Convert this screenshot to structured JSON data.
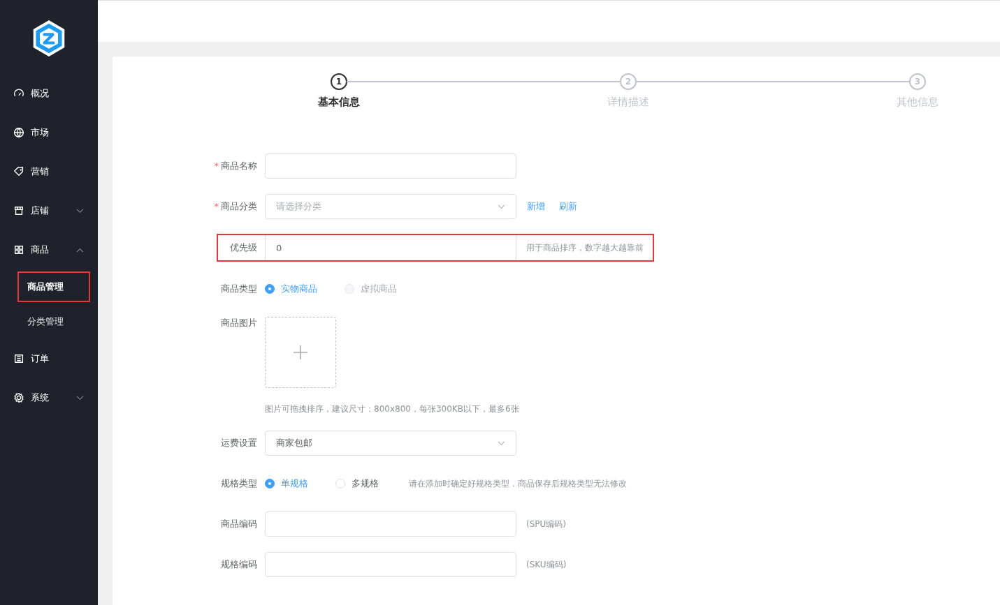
{
  "sidebar": {
    "items": [
      {
        "label": "概况"
      },
      {
        "label": "市场"
      },
      {
        "label": "营销"
      },
      {
        "label": "店铺",
        "expanded": false
      },
      {
        "label": "商品",
        "expanded": true,
        "children": [
          {
            "label": "商品管理",
            "selected": true,
            "highlighted": true
          },
          {
            "label": "分类管理",
            "selected": false,
            "highlighted": false
          }
        ]
      },
      {
        "label": "订单"
      },
      {
        "label": "系统",
        "expanded": false
      }
    ]
  },
  "steps": [
    {
      "number": "1",
      "label": "基本信息",
      "selected": true
    },
    {
      "number": "2",
      "label": "详情描述",
      "selected": false
    },
    {
      "number": "3",
      "label": "其他信息",
      "selected": false
    }
  ],
  "form": {
    "fields": [
      {
        "kind": "input",
        "required_mark": "*",
        "label": "商品名称",
        "highlighted": false
      },
      {
        "kind": "select",
        "required_mark": "*",
        "label": "商品分类",
        "placeholder": "请选择分类",
        "links": [
          "新增",
          "刷新"
        ],
        "highlighted": false
      },
      {
        "kind": "input",
        "label": "优先级",
        "value": "0",
        "append": "用于商品排序，数字越大越靠前",
        "highlighted": true
      },
      {
        "kind": "radio",
        "label": "商品类型",
        "options": [
          {
            "label": "实物商品",
            "selected": true,
            "disabled": false
          },
          {
            "label": "虚拟商品",
            "selected": false,
            "disabled": true
          }
        ],
        "highlighted": false
      },
      {
        "kind": "upload",
        "label": "商品图片",
        "tip": "图片可拖拽排序，建议尺寸：800x800，每张300KB以下，最多6张",
        "highlighted": false
      },
      {
        "kind": "select",
        "label": "运费设置",
        "value": "商家包邮",
        "highlighted": false
      },
      {
        "kind": "radio",
        "label": "规格类型",
        "options": [
          {
            "label": "单规格",
            "selected": true,
            "disabled": false
          },
          {
            "label": "多规格",
            "selected": false,
            "disabled": false
          }
        ],
        "hint": "请在添加时确定好规格类型，商品保存后规格类型无法修改",
        "highlighted": false
      },
      {
        "kind": "input",
        "label": "商品编码",
        "note": "(SPU编码)",
        "highlighted": false
      },
      {
        "kind": "input",
        "label": "规格编码",
        "note": "(SKU编码)",
        "highlighted": false
      }
    ]
  }
}
